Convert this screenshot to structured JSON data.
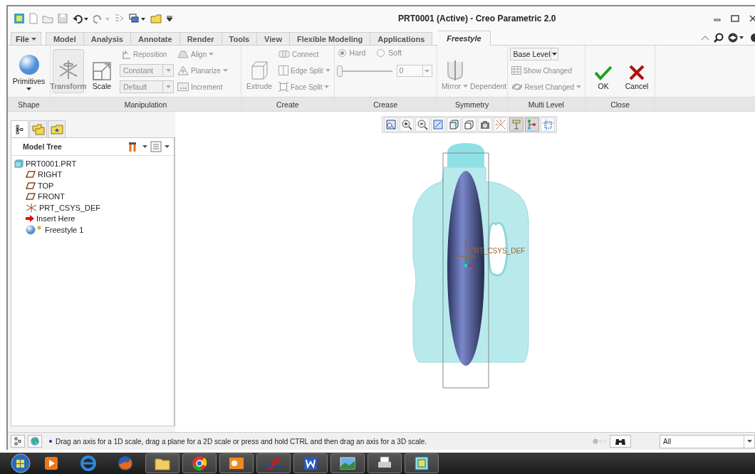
{
  "window": {
    "title": "PRT0001 (Active) - Creo Parametric 2.0"
  },
  "file_menu": "File",
  "tabs": [
    {
      "label": "Model",
      "selected": false
    },
    {
      "label": "Analysis",
      "selected": false
    },
    {
      "label": "Annotate",
      "selected": false
    },
    {
      "label": "Render",
      "selected": false
    },
    {
      "label": "Tools",
      "selected": false
    },
    {
      "label": "View",
      "selected": false
    },
    {
      "label": "Flexible Modeling",
      "selected": false
    },
    {
      "label": "Applications",
      "selected": false
    },
    {
      "label": "Freestyle",
      "selected": true
    }
  ],
  "ribbon": [
    {
      "label": "Shape",
      "columns": [
        [
          {
            "kind": "large",
            "label": "Primitives",
            "disabled": false,
            "pressed": false,
            "dropdown": true
          }
        ]
      ]
    },
    {
      "label": "Manipulation",
      "columns": [
        [
          {
            "kind": "large",
            "label": "Transform",
            "disabled": true,
            "pressed": true,
            "dropdown": false
          }
        ],
        [
          {
            "kind": "large",
            "label": "Scale",
            "disabled": false,
            "pressed": false,
            "dropdown": false
          }
        ],
        [
          {
            "kind": "small",
            "label": "Reposition",
            "disabled": true,
            "dropdown": false
          },
          {
            "kind": "select",
            "value": "Constant",
            "disabled": true
          },
          {
            "kind": "select",
            "value": "Default",
            "disabled": true
          }
        ],
        [
          {
            "kind": "small",
            "label": "Align",
            "disabled": true,
            "dropdown": true
          },
          {
            "kind": "small",
            "label": "Planarize",
            "disabled": true,
            "dropdown": true
          },
          {
            "kind": "small",
            "label": "Increment",
            "disabled": true,
            "dropdown": false
          }
        ]
      ]
    },
    {
      "label": "Create",
      "columns": [
        [
          {
            "kind": "large",
            "label": "Extrude",
            "disabled": true,
            "pressed": false,
            "dropdown": false
          }
        ],
        [
          {
            "kind": "small",
            "label": "Connect",
            "disabled": true,
            "dropdown": false
          },
          {
            "kind": "small",
            "label": "Edge Split",
            "disabled": true,
            "dropdown": true
          },
          {
            "kind": "small",
            "label": "Face Split",
            "disabled": true,
            "dropdown": true
          }
        ]
      ]
    },
    {
      "label": "Crease",
      "columns": [
        [
          {
            "kind": "radios",
            "options": [
              {
                "label": "Hard",
                "selected": true,
                "disabled": true
              },
              {
                "label": "Soft",
                "selected": false,
                "disabled": true
              }
            ]
          },
          {
            "kind": "slider",
            "level": 0,
            "value": "0",
            "disabled": true
          }
        ]
      ]
    },
    {
      "label": "Symmetry",
      "columns": [
        [
          {
            "kind": "large",
            "label": "Mirror",
            "disabled": true,
            "pressed": false,
            "dropdown": true
          }
        ],
        [
          {
            "kind": "large",
            "label": "Dependent",
            "disabled": true,
            "pressed": false,
            "dropdown": false
          }
        ]
      ]
    },
    {
      "label": "Multi Level",
      "columns": [
        [
          {
            "kind": "select",
            "value": "Base Level",
            "disabled": false
          },
          {
            "kind": "small",
            "label": "Show Changed",
            "disabled": true,
            "dropdown": false
          },
          {
            "kind": "small",
            "label": "Reset Changed",
            "disabled": true,
            "dropdown": true
          }
        ]
      ]
    },
    {
      "label": "Close",
      "columns": [
        [
          {
            "kind": "large",
            "label": "OK",
            "disabled": false,
            "pressed": false,
            "dropdown": false
          }
        ],
        [
          {
            "kind": "large",
            "label": "Cancel",
            "disabled": false,
            "pressed": false,
            "dropdown": false
          }
        ]
      ]
    }
  ],
  "navigator_tabs": [
    {
      "selected": true
    },
    {
      "selected": false
    },
    {
      "selected": false
    }
  ],
  "model_tree": {
    "header": "Model Tree",
    "items": [
      {
        "kind": "part",
        "label": "PRT0001.PRT",
        "children": [
          {
            "kind": "plane",
            "label": "RIGHT"
          },
          {
            "kind": "plane",
            "label": "TOP"
          },
          {
            "kind": "plane",
            "label": "FRONT"
          },
          {
            "kind": "csys",
            "label": "PRT_CSYS_DEF"
          },
          {
            "kind": "insert",
            "label": "Insert Here"
          },
          {
            "kind": "freestyle",
            "label": "Freestyle 1"
          }
        ]
      }
    ]
  },
  "view_toolbar": [
    {
      "on": false
    },
    {
      "on": false
    },
    {
      "on": false
    },
    {
      "on": false
    },
    {
      "on": false
    },
    {
      "on": false
    },
    {
      "on": false
    },
    {
      "on": false
    },
    {
      "on": true
    },
    {
      "on": true
    },
    {
      "on": false
    }
  ],
  "viewport": {
    "csys_label": "PRT_CSYS_DEF"
  },
  "status_bar": {
    "message": "Drag an axis for a 1D scale, drag a plane for a 2D scale or press and hold CTRL and then drag an axis for a 3D scale.",
    "filter": "All"
  }
}
